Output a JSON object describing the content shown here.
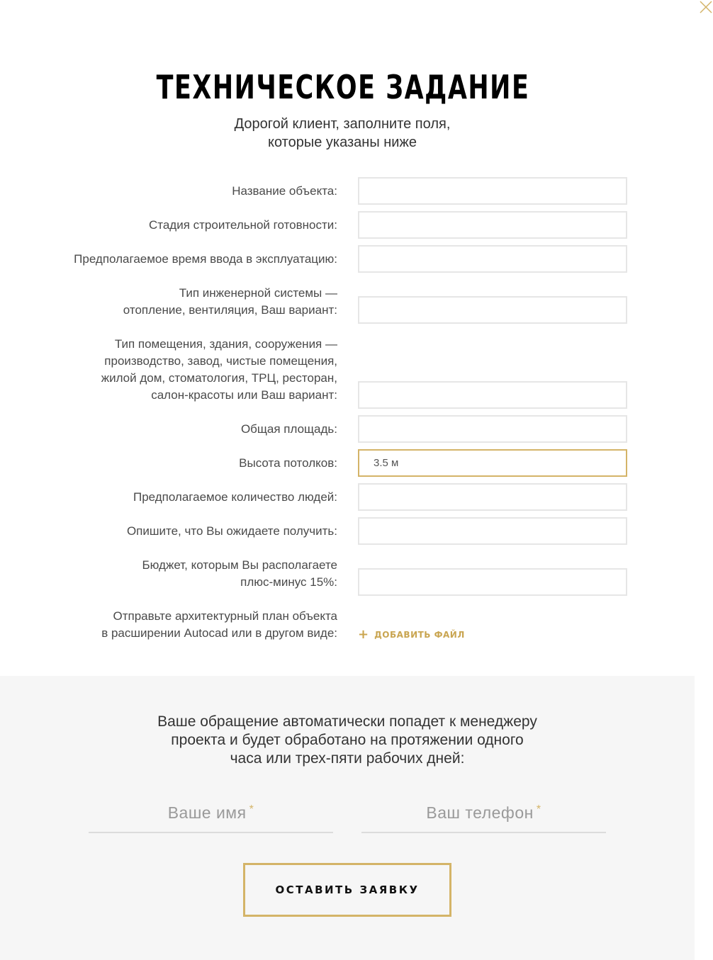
{
  "header": {
    "title": "ТЕХНИЧЕСКОЕ ЗАДАНИЕ",
    "subtitle": "Дорогой клиент, заполните поля,\nкоторые указаны ниже"
  },
  "form": {
    "fields": [
      {
        "label": "Название объекта:",
        "value": ""
      },
      {
        "label": "Стадия строительной готовности:",
        "value": ""
      },
      {
        "label": "Предполагаемое время ввода в эксплуатацию:",
        "value": ""
      },
      {
        "label": "Тип инженерной системы —\nотопление, вентиляция, Ваш вариант:",
        "value": ""
      },
      {
        "label": "Тип помещения, здания, сооружения —\nпроизводство, завод, чистые помещения,\nжилой дом, стоматология, ТРЦ, ресторан,\nсалон-красоты или Ваш вариант:",
        "value": ""
      },
      {
        "label": "Общая площадь:",
        "value": ""
      },
      {
        "label": "Высота потолков:",
        "value": "3.5 м"
      },
      {
        "label": "Предполагаемое количество людей:",
        "value": ""
      },
      {
        "label": "Опишите, что Вы ожидаете получить:",
        "value": ""
      },
      {
        "label": "Бюджет, которым Вы располагаете\nплюс-минус 15%:",
        "value": ""
      }
    ],
    "file": {
      "label": "Отправьте архитектурный план объекта\nв расширении Autocad или в другом виде:",
      "button": "ДОБАВИТЬ ФАЙЛ"
    }
  },
  "footer": {
    "notice": "Ваше обращение автоматически попадет к менеджеру\nпроекта и будет обработано на протяжении одного\nчаса или трех-пяти рабочих дней:",
    "name_placeholder": "Ваше имя",
    "phone_placeholder": "Ваш телефон",
    "required_mark": "*",
    "submit": "ОСТАВИТЬ ЗАЯВКУ"
  },
  "colors": {
    "accent": "#d4b468",
    "footer_bg": "#f6f6f6"
  }
}
